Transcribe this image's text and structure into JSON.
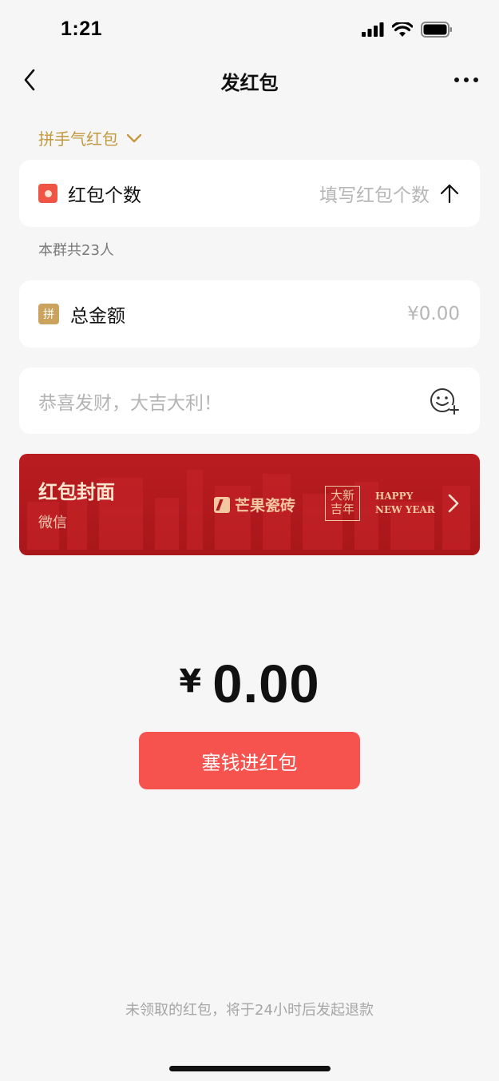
{
  "status": {
    "time": "1:21"
  },
  "nav": {
    "title": "发红包"
  },
  "type_selector": {
    "label": "拼手气红包"
  },
  "count_row": {
    "label": "红包个数",
    "placeholder": "填写红包个数"
  },
  "group_info": {
    "text": "本群共23人"
  },
  "amount_row": {
    "icon_text": "拼",
    "label": "总金额",
    "value": "¥0.00"
  },
  "greeting": {
    "placeholder": "恭喜发财，大吉大利！"
  },
  "cover": {
    "title": "红包封面",
    "subtitle": "微信",
    "brand": "芒果瓷砖",
    "seal_line1": "大新",
    "seal_line2": "吉年",
    "happy_line1": "HAPPY",
    "happy_line2": "NEW YEAR"
  },
  "total": {
    "currency": "¥",
    "value": "0.00"
  },
  "submit": {
    "label": "塞钱进红包"
  },
  "footer_note": "未领取的红包，将于24小时后发起退款",
  "colors": {
    "accent_red": "#f7534e",
    "gold": "#c29a3e",
    "banner_red": "#b01a1e"
  },
  "icons": [
    "signal-icon",
    "wifi-icon",
    "battery-icon",
    "back-icon",
    "more-icon",
    "chevron-down-icon",
    "red-packet-icon",
    "arrow-up-icon",
    "emoji-add-icon",
    "chevron-right-icon"
  ]
}
